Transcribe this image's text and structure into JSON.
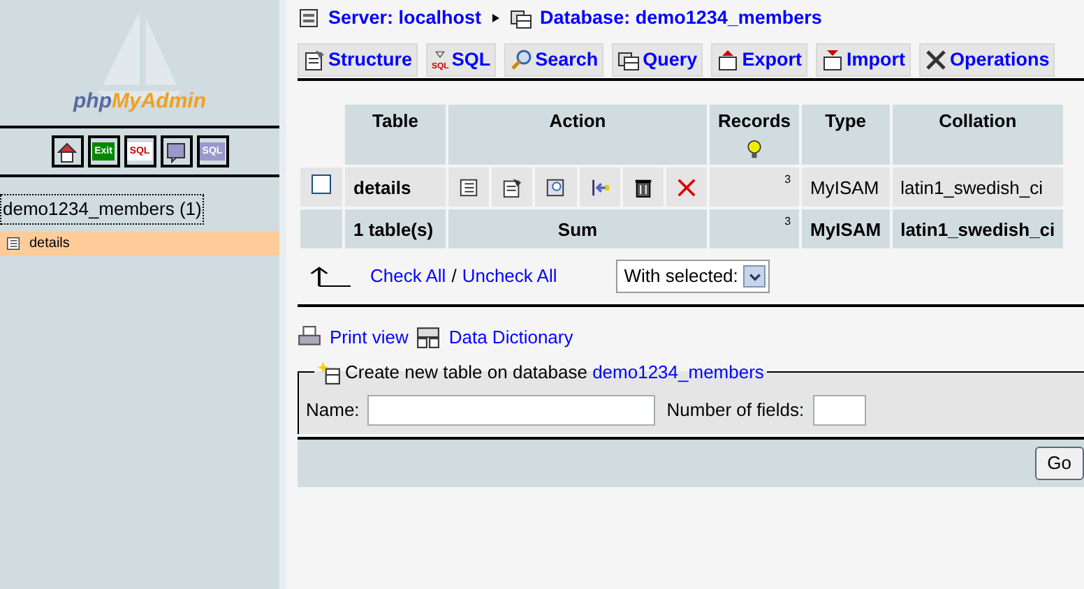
{
  "sidebar": {
    "logo": {
      "part_1": "php",
      "part_2": "MyAdmin"
    },
    "nav_buttons": [
      {
        "kind": "home"
      },
      {
        "kind": "exit",
        "label": "Exit"
      },
      {
        "kind": "sql",
        "label": "SQL"
      },
      {
        "kind": "help"
      },
      {
        "kind": "query",
        "label": "SQL"
      }
    ],
    "database": {
      "label": "demo1234_members (1)",
      "focused": true
    },
    "tables": [
      {
        "label": "details",
        "selected": true
      }
    ]
  },
  "breadcrumb": [
    {
      "kind": "server",
      "label": "Server: localhost"
    },
    {
      "kind": "database",
      "label": "Database: demo1234_members"
    }
  ],
  "tabs": [
    {
      "kind": "structure",
      "label": "Structure",
      "selected": false
    },
    {
      "kind": "sql",
      "label": "SQL",
      "icon_label": "SQL",
      "selected": false
    },
    {
      "kind": "search",
      "label": "Search",
      "selected": false
    },
    {
      "kind": "query",
      "label": "Query",
      "selected": false
    },
    {
      "kind": "export",
      "label": "Export",
      "selected": false
    },
    {
      "kind": "import",
      "label": "Import",
      "selected": false
    },
    {
      "kind": "operations",
      "label": "Operations",
      "selected": false
    }
  ],
  "table": {
    "columns": [
      "Table",
      "Action",
      "Records",
      "Type",
      "Collation"
    ],
    "rows": [
      {
        "checked": false,
        "name": "details",
        "actions": [
          {
            "kind": "browse"
          },
          {
            "kind": "structure"
          },
          {
            "kind": "search"
          },
          {
            "kind": "insert"
          },
          {
            "kind": "empty"
          },
          {
            "kind": "drop"
          }
        ],
        "records": "3",
        "type": "MyISAM",
        "collation": "latin1_swedish_ci"
      }
    ],
    "summary": {
      "name": "1 table(s)",
      "action": "Sum",
      "records": "3",
      "type": "MyISAM",
      "collation": "latin1_swedish_ci"
    }
  },
  "bulk": {
    "check_all": "Check All",
    "separator": "/",
    "uncheck_all": "Uncheck All",
    "with_selected": "With selected:"
  },
  "links": [
    {
      "kind": "print",
      "label": "Print view"
    },
    {
      "kind": "dictionary",
      "label": "Data Dictionary"
    }
  ],
  "create_table": {
    "legend": "Create new table on database",
    "database": "demo1234_members",
    "name_label": "Name:",
    "fields_label": "Number of fields:",
    "go": "Go"
  }
}
